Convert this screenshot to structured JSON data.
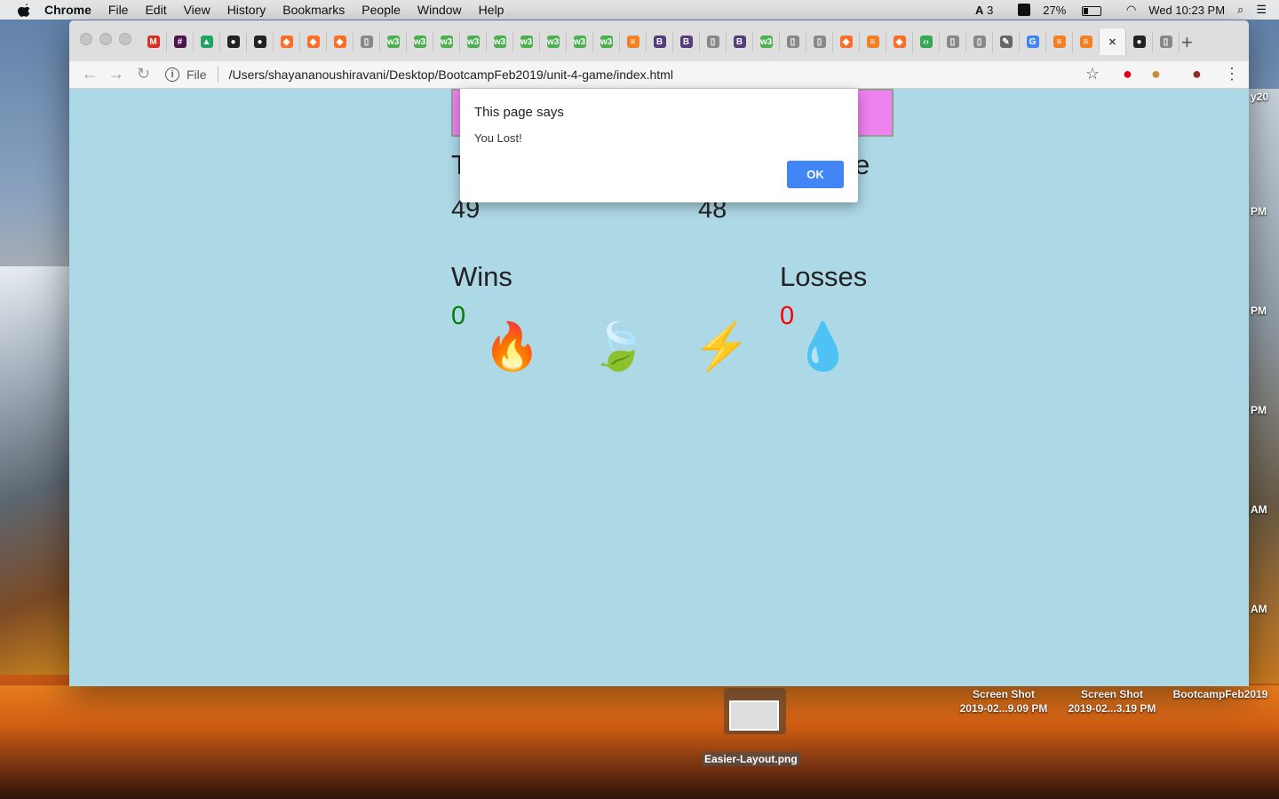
{
  "menubar": {
    "app": "Chrome",
    "items": [
      "File",
      "Edit",
      "View",
      "History",
      "Bookmarks",
      "People",
      "Window",
      "Help"
    ],
    "status": {
      "adobe": "3",
      "battery": "27%",
      "clock": "Wed 10:23 PM"
    }
  },
  "browser": {
    "tabs": [
      {
        "icon": "gmail-icon",
        "glyph": "M",
        "color": "#d93025"
      },
      {
        "icon": "slack-icon",
        "glyph": "#",
        "color": "#4a154b"
      },
      {
        "icon": "drive-icon",
        "glyph": "▲",
        "color": "#1fa463"
      },
      {
        "icon": "github-icon",
        "glyph": "●",
        "color": "#222"
      },
      {
        "icon": "github-icon",
        "glyph": "●",
        "color": "#222"
      },
      {
        "icon": "gitlab-icon",
        "glyph": "◆",
        "color": "#fc6d26"
      },
      {
        "icon": "gitlab-icon",
        "glyph": "◆",
        "color": "#fc6d26"
      },
      {
        "icon": "gitlab-icon",
        "glyph": "◆",
        "color": "#fc6d26"
      },
      {
        "icon": "page-icon",
        "glyph": "▯",
        "color": "#888"
      },
      {
        "icon": "w3schools-icon",
        "glyph": "w3",
        "color": "#4caf50"
      },
      {
        "icon": "w3schools-icon",
        "glyph": "w3",
        "color": "#4caf50"
      },
      {
        "icon": "w3schools-icon",
        "glyph": "w3",
        "color": "#4caf50"
      },
      {
        "icon": "w3schools-icon",
        "glyph": "w3",
        "color": "#4caf50"
      },
      {
        "icon": "w3schools-icon",
        "glyph": "w3",
        "color": "#4caf50"
      },
      {
        "icon": "w3schools-icon",
        "glyph": "w3",
        "color": "#4caf50"
      },
      {
        "icon": "w3schools-icon",
        "glyph": "w3",
        "color": "#4caf50"
      },
      {
        "icon": "w3schools-icon",
        "glyph": "w3",
        "color": "#4caf50"
      },
      {
        "icon": "w3schools-icon",
        "glyph": "w3",
        "color": "#4caf50"
      },
      {
        "icon": "stackoverflow-icon",
        "glyph": "≡",
        "color": "#f48024"
      },
      {
        "icon": "bootstrap-icon",
        "glyph": "B",
        "color": "#563d7c"
      },
      {
        "icon": "bootstrap-icon",
        "glyph": "B",
        "color": "#563d7c"
      },
      {
        "icon": "page-icon",
        "glyph": "▯",
        "color": "#888"
      },
      {
        "icon": "bootstrap-icon",
        "glyph": "B",
        "color": "#563d7c"
      },
      {
        "icon": "w3schools-icon",
        "glyph": "w3",
        "color": "#4caf50"
      },
      {
        "icon": "page-icon",
        "glyph": "▯",
        "color": "#888"
      },
      {
        "icon": "page-icon",
        "glyph": "▯",
        "color": "#888"
      },
      {
        "icon": "gitlab-icon",
        "glyph": "◆",
        "color": "#fc6d26"
      },
      {
        "icon": "stackoverflow-icon",
        "glyph": "≡",
        "color": "#f48024"
      },
      {
        "icon": "gitlab-icon",
        "glyph": "◆",
        "color": "#fc6d26"
      },
      {
        "icon": "chrome-extension-icon",
        "glyph": "‹›",
        "color": "#34a853"
      },
      {
        "icon": "page-icon",
        "glyph": "▯",
        "color": "#888"
      },
      {
        "icon": "page-icon",
        "glyph": "▯",
        "color": "#888"
      },
      {
        "icon": "extension-icon",
        "glyph": "✎",
        "color": "#666"
      },
      {
        "icon": "google-icon",
        "glyph": "G",
        "color": "#4285f4"
      },
      {
        "icon": "stackoverflow-icon",
        "glyph": "≡",
        "color": "#f48024"
      },
      {
        "icon": "stackoverflow-icon",
        "glyph": "≡",
        "color": "#f48024"
      }
    ],
    "active_tab_close": "✕",
    "after_active_tabs": [
      {
        "icon": "github-icon",
        "glyph": "●",
        "color": "#222"
      },
      {
        "icon": "page-icon",
        "glyph": "▯",
        "color": "#888"
      }
    ],
    "new_tab": "+",
    "scheme": "File",
    "url": "/Users/shayananoushiravani/Desktop/BootcampFeb2019/unit-4-game/index.html"
  },
  "game": {
    "target_score": "49",
    "your_score": "48",
    "wins_label": "Wins",
    "wins": "0",
    "losses_label": "Losses",
    "losses": "0",
    "crystals": [
      {
        "name": "fire-crystal-icon",
        "glyph": "🔥"
      },
      {
        "name": "leaf-crystal-icon",
        "glyph": "🍃"
      },
      {
        "name": "lightning-crystal-icon",
        "glyph": "⚡"
      },
      {
        "name": "water-crystal-icon",
        "glyph": "💧"
      }
    ],
    "colors": {
      "wins": "#008000",
      "losses": "#ff0000",
      "background": "#add8e6",
      "banner": "#ee82ee"
    }
  },
  "alert": {
    "title": "This page says",
    "message": "You Lost!",
    "ok_label": "OK"
  },
  "desktop": {
    "file_name": "Easier-Layout.png",
    "items": [
      {
        "line1": "Screen Shot",
        "line2": "2019-02...9.09 PM"
      },
      {
        "line1": "Screen Shot",
        "line2": "2019-02...3.19 PM"
      },
      {
        "line1": "BootcampFeb2019",
        "line2": ""
      }
    ],
    "side_times": [
      "PM",
      "PM",
      "PM",
      "AM",
      "AM"
    ],
    "edge_text": "y20"
  }
}
